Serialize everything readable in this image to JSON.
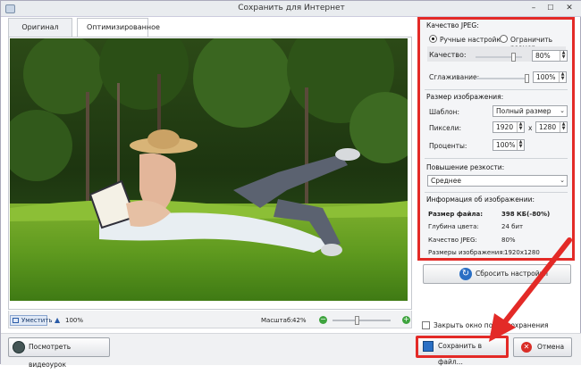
{
  "window": {
    "title": "Сохранить для Интернет",
    "minimize_glyph": "–",
    "maximize_glyph": "☐",
    "close_glyph": "✕"
  },
  "tabs": [
    {
      "label": "Оригинал",
      "active": false
    },
    {
      "label": "Оптимизированное",
      "active": true
    }
  ],
  "preview_toolbar": {
    "fit_label": "Уместить",
    "zoom_label": "100%",
    "scale_label": "Масштаб:",
    "scale_value": "42%",
    "scale_level_percent": 42,
    "minus_glyph": "−",
    "plus_glyph": "+"
  },
  "settings": {
    "jpeg_section_title": "Качество JPEG:",
    "mode_manual_label": "Ручные настройки",
    "mode_limit_label": "Ограничить размер",
    "mode_selected": "manual",
    "quality_label": "Качество:",
    "quality_value": "80%",
    "quality_level_percent": 80,
    "smoothing_label": "Сглаживание:",
    "smoothing_value": "100%",
    "smoothing_level_percent": 100,
    "size_section_title": "Размер изображения:",
    "template_label": "Шаблон:",
    "template_value": "Полный размер",
    "pixels_label": "Пиксели:",
    "width_value": "1920",
    "times_glyph": "x",
    "height_value": "1280",
    "percent_label": "Проценты:",
    "percent_value": "100%",
    "sharpen_section_title": "Повышение резкости:",
    "sharpen_value": "Среднее",
    "info_section_title": "Информация об изображении:",
    "info": [
      {
        "key": "Размер файла:",
        "value": "398 КБ(-80%)",
        "bold": true
      },
      {
        "key": "Глубина цвета:",
        "value": "24 бит",
        "bold": false
      },
      {
        "key": "Качество JPEG:",
        "value": "80%",
        "bold": false
      },
      {
        "key": "Размеры изображения:",
        "value": "1920x1280",
        "bold": false
      }
    ]
  },
  "reset_button_label": "Сбросить настройки",
  "close_after_save_label": "Закрыть окно после сохранения",
  "close_after_save_checked": false,
  "footer": {
    "video_button_label": "Посмотреть видеоурок",
    "save_button_label": "Сохранить в файл...",
    "cancel_button_label": "Отмена"
  },
  "colors": {
    "highlight": "#e32a27",
    "accent_blue": "#2a6fc4",
    "green": "#3fa43f"
  }
}
